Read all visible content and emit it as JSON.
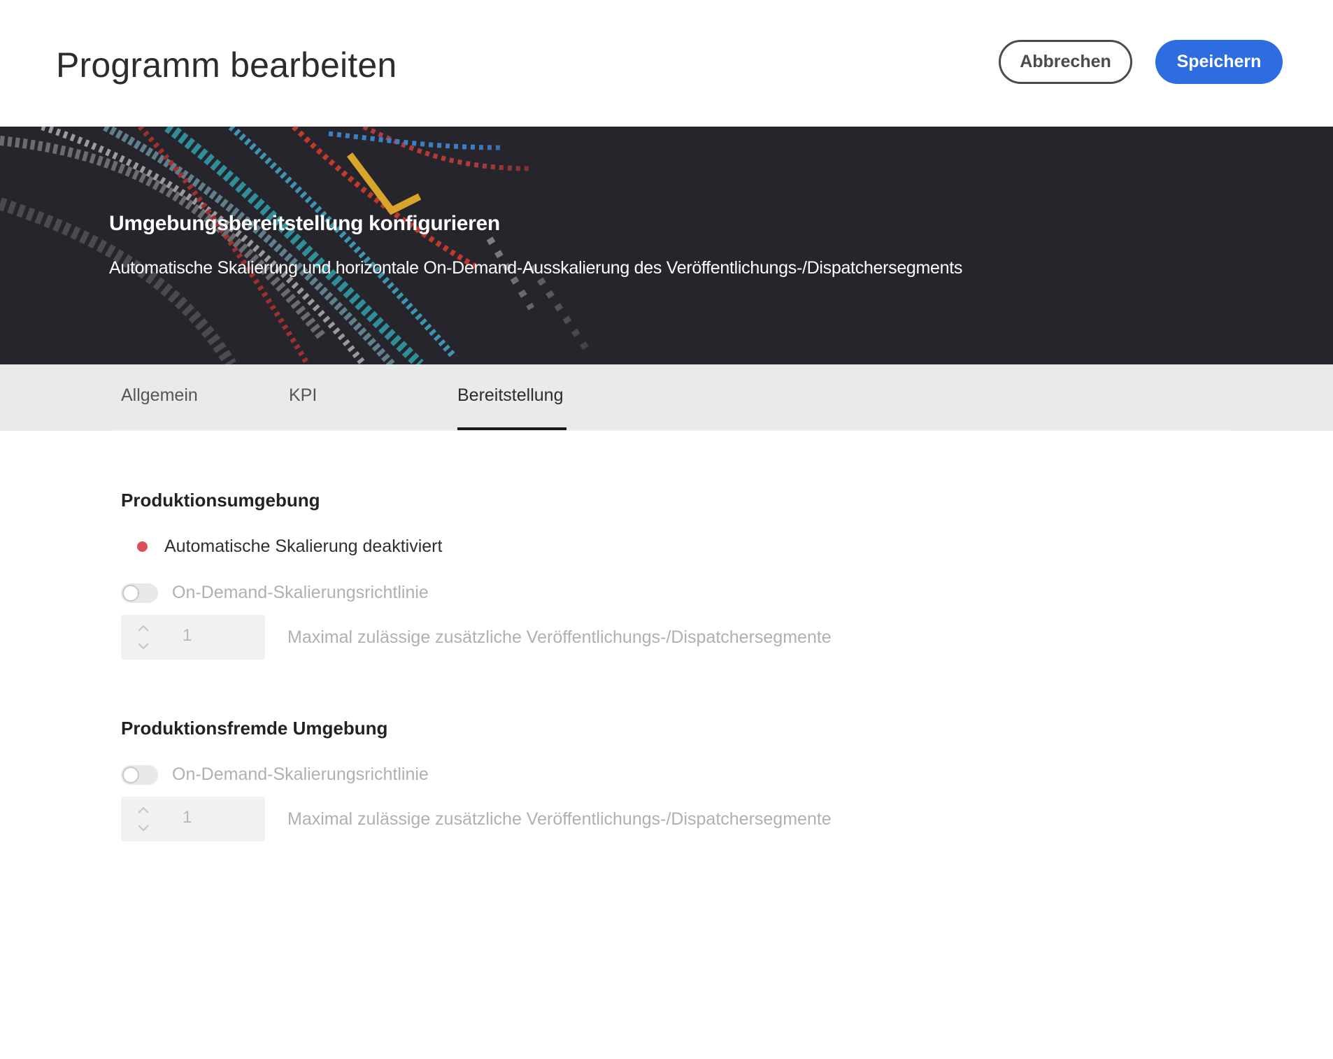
{
  "header": {
    "title": "Programm bearbeiten",
    "cancel_label": "Abbrechen",
    "save_label": "Speichern"
  },
  "hero": {
    "title": "Umgebungsbereitstellung konfigurieren",
    "subtitle": "Automatische Skalierung und horizontale On-Demand-Ausskalierung des Veröffentlichungs-/Dispatchersegments"
  },
  "tabs": [
    {
      "label": "Allgemein",
      "active": false
    },
    {
      "label": "KPI",
      "active": false
    },
    {
      "label": "Bereitstellung",
      "active": true
    }
  ],
  "production": {
    "title": "Produktionsumgebung",
    "status_text": "Automatische Skalierung deaktiviert",
    "status_color": "#d9505b",
    "toggle_label": "On-Demand-Skalierungsrichtlinie",
    "toggle_on": false,
    "stepper_value": "1",
    "stepper_label": "Maximal zulässige zusätzliche Veröffentlichungs-/Dispatchersegmente"
  },
  "nonproduction": {
    "title": "Produktionsfremde Umgebung",
    "toggle_label": "On-Demand-Skalierungsrichtlinie",
    "toggle_on": false,
    "stepper_value": "1",
    "stepper_label": "Maximal zulässige zusätzliche Veröffentlichungs-/Dispatchersegmente"
  },
  "colors": {
    "accent": "#2d6ddf",
    "hero_background": "#26252b"
  }
}
